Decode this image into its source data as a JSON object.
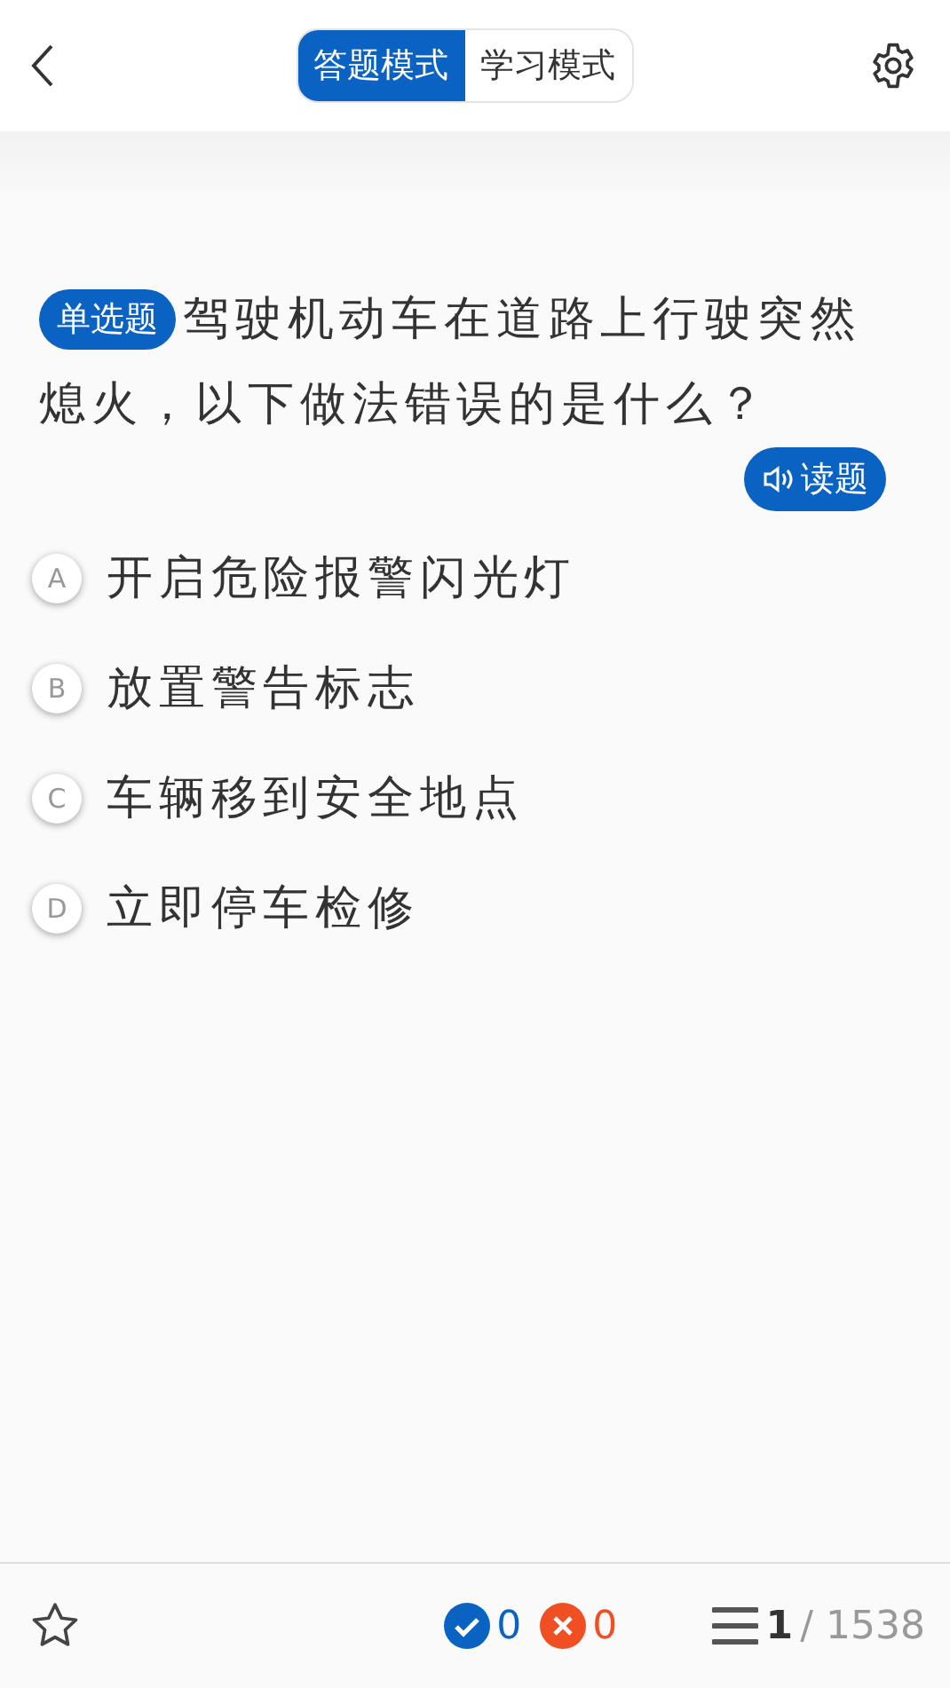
{
  "header": {
    "modes": [
      {
        "label": "答题模式",
        "selected": true
      },
      {
        "label": "学习模式",
        "selected": false
      }
    ]
  },
  "question": {
    "type_tag": "单选题",
    "text": "驾驶机动车在道路上行驶突然熄火，以下做法错误的是什么？",
    "read_button": "读题"
  },
  "options": [
    {
      "letter": "A",
      "text": "开启危险报警闪光灯",
      "selected": false
    },
    {
      "letter": "B",
      "text": "放置警告标志",
      "selected": false
    },
    {
      "letter": "C",
      "text": "车辆移到安全地点",
      "selected": false
    },
    {
      "letter": "D",
      "text": "立即停车检修",
      "selected": false
    }
  ],
  "footer": {
    "favorite": false,
    "correct_count": "0",
    "wrong_count": "0",
    "current": "1",
    "total": "/ 1538"
  }
}
